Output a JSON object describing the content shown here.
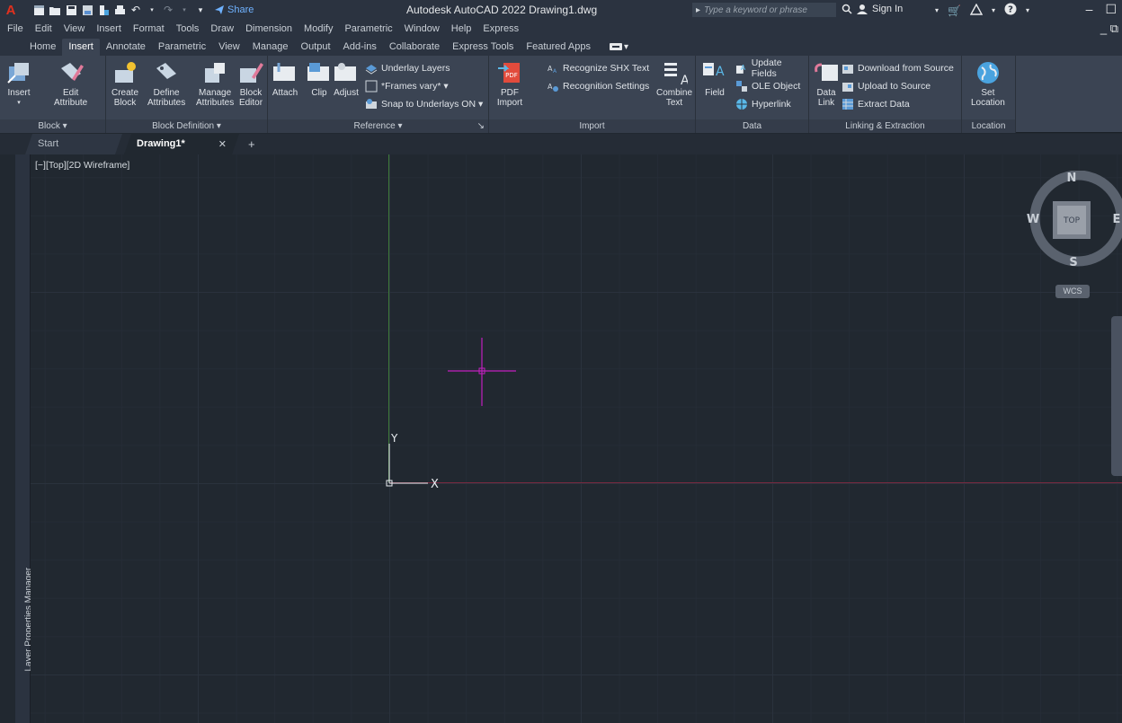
{
  "titlebar": {
    "app_logo": "A",
    "share_label": "Share",
    "title": "Autodesk AutoCAD 2022   Drawing1.dwg",
    "search_placeholder": "Type a keyword or phrase",
    "sign_in": "Sign In"
  },
  "menu": [
    "File",
    "Edit",
    "View",
    "Insert",
    "Format",
    "Tools",
    "Draw",
    "Dimension",
    "Modify",
    "Parametric",
    "Window",
    "Help",
    "Express"
  ],
  "ribbon_tabs": [
    "Home",
    "Insert",
    "Annotate",
    "Parametric",
    "View",
    "Manage",
    "Output",
    "Add-ins",
    "Collaborate",
    "Express Tools",
    "Featured Apps"
  ],
  "active_tab": "Insert",
  "panels": {
    "block": {
      "title": "Block ▾",
      "insert": "Insert",
      "edit_attribute_1": "Edit",
      "edit_attribute_2": "Attribute"
    },
    "block_definition": {
      "title": "Block Definition ▾",
      "create_1": "Create",
      "create_2": "Block",
      "define_1": "Define",
      "define_2": "Attributes",
      "manage_1": "Manage",
      "manage_2": "Attributes",
      "editor_1": "Block",
      "editor_2": "Editor"
    },
    "reference": {
      "title": "Reference ▾",
      "attach": "Attach",
      "clip": "Clip",
      "adjust": "Adjust",
      "underlay_layers": "Underlay Layers",
      "frames_vary": "*Frames vary* ▾",
      "snap_underlays": "Snap to Underlays ON ▾"
    },
    "import": {
      "title": "Import",
      "pdf_1": "PDF",
      "pdf_2": "Import",
      "recognize_shx": "Recognize SHX Text",
      "recognition_settings": "Recognition Settings",
      "combine_1": "Combine",
      "combine_2": "Text"
    },
    "data": {
      "title": "Data",
      "field": "Field",
      "update_fields": "Update Fields",
      "ole_object": "OLE Object",
      "hyperlink": "Hyperlink"
    },
    "linking": {
      "title": "Linking & Extraction",
      "data_link_1": "Data",
      "data_link_2": "Link",
      "download_source": "Download from Source",
      "upload_source": "Upload to Source",
      "extract_data": "Extract  Data"
    },
    "location": {
      "title": "Location",
      "set_1": "Set",
      "set_2": "Location"
    }
  },
  "file_tabs": {
    "start": "Start",
    "drawing": "Drawing1*",
    "close": "✕",
    "add": "+"
  },
  "viewport_label": "[−][Top][2D Wireframe]",
  "side_palette_label": "Layer Properties Manager",
  "ucs": {
    "x": "X",
    "y": "Y"
  },
  "viewcube": {
    "n": "N",
    "s": "S",
    "e": "E",
    "w": "W",
    "face": "TOP",
    "wcs": "WCS"
  },
  "colors": {
    "crosshair": "#c21fbf",
    "x_axis": "#7a2a40",
    "y_axis": "#3e7a3a",
    "canvas": "#212830"
  }
}
